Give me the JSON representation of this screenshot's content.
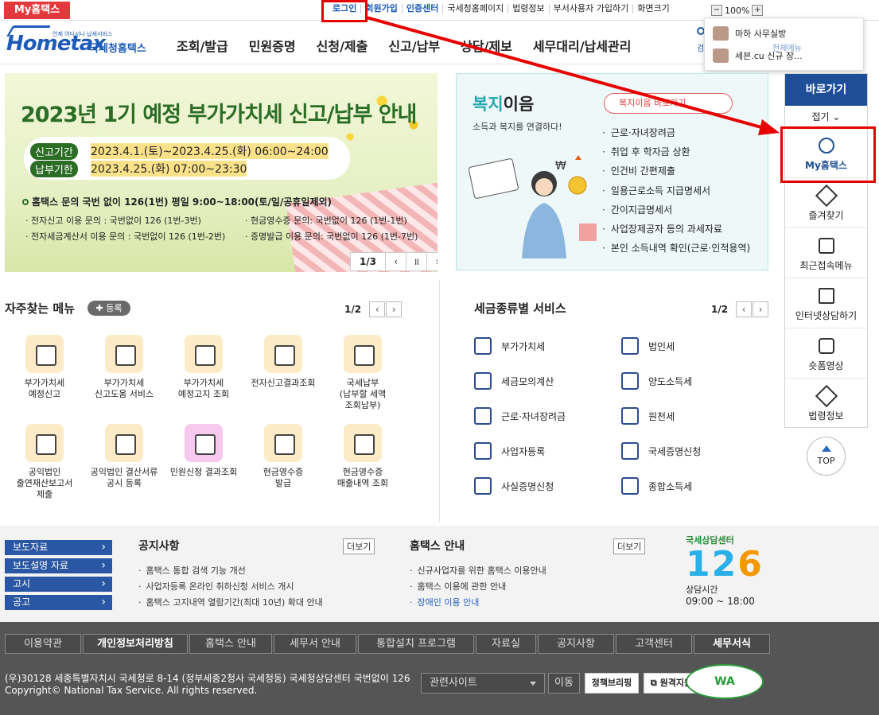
{
  "topbar": {
    "my_tab": "My홈택스",
    "links": [
      "로그인",
      "회원가입",
      "인증센터",
      "국세청홈페이지",
      "법령정보",
      "부서사용자 가입하기",
      "화면크기"
    ],
    "zoom": "100%"
  },
  "logo": {
    "sub": "언제 어디서나 납세서비스",
    "brand": "Hometax",
    "name": "국세청홈택스"
  },
  "gnb": [
    "조회/발급",
    "민원증명",
    "신청/제출",
    "신고/납부",
    "상담/제보",
    "세무대리/납세관리"
  ],
  "popup": {
    "items": [
      "마하 사무실방",
      "세븐.cu 신규 장..."
    ],
    "side": [
      "검",
      "전체메뉴"
    ]
  },
  "banner": {
    "title": "2023년 1기 예정 부가가치세 신고/납부 안내",
    "period1_label": "신고기간",
    "period1": "2023.4.1.(토)~2023.4.25.(화) 06:00~24:00",
    "period2_label": "납부기한",
    "period2": "2023.4.25.(화) 07:00~23:30",
    "info": "홈택스 문의 국번 없이 126(1번) 평일 9:00~18:00(토/일/공휴일제외)",
    "lines": [
      "· 전자신고 이용 문의 : 국번없이 126 (1번-3번)",
      "· 현금영수증 문의: 국번없이 126 (1번-1번)",
      "· 전자세금계산서 이용 문의 : 국번없이 126 (1번-2번)",
      "· 증명발급 이용 문의: 국번없이 126 (1번-7번)"
    ],
    "page": "1/3"
  },
  "welfare": {
    "title_a": "복지",
    "title_b": "이음",
    "sub": "소득과 복지를 연결하다!",
    "button": "복지이음 바로가기",
    "items": [
      "근로·자녀장려금",
      "취업 후 학자금 상환",
      "인건비 간편제출",
      "일용근로소득 지급명세서",
      "간이지급명세서",
      "사업장제공자 등의 과세자료",
      "본인 소득내역 확인(근로·인적용역)"
    ]
  },
  "frequent": {
    "title": "자주찾는 메뉴",
    "add": "등록",
    "page": "1/2",
    "items": [
      "부가가치세\n예정신고",
      "부가가치세\n신고도움 서비스",
      "부가가치세\n예정고지 조회",
      "전자신고결과조회",
      "국세납부\n(납부할 세액\n조회납부)",
      "공익법인\n출연재산보고서\n제출",
      "공익법인 결산서류\n공시 등록",
      "민원신청 결과조회",
      "현금영수증\n발급",
      "현금영수증\n매출내역 조회"
    ]
  },
  "taxservice": {
    "title": "세금종류별 서비스",
    "page": "1/2",
    "items": [
      "부가가치세",
      "법인세",
      "세금모의계산",
      "양도소득세",
      "근로·자녀장려금",
      "원천세",
      "사업자등록",
      "국세증명신청",
      "사실증명신청",
      "종합소득세"
    ]
  },
  "quick": {
    "title": "바로가기",
    "fold": "접기",
    "items": [
      "My홈택스",
      "즐겨찾기",
      "최근접속메뉴",
      "인터넷상담하기",
      "숏폼영상",
      "법령정보"
    ],
    "top": "TOP"
  },
  "news": {
    "tabs": [
      "보도자료",
      "보도설명 자료",
      "고시",
      "공고"
    ],
    "notice_title": "공지사항",
    "notice_more": "더보기",
    "notices": [
      "홈택스 통합 검색 기능 개선",
      "사업자등록 온라인 취하신청 서비스 개시",
      "홈택스 고지내역 열람기간(최대 10년) 확대 안내"
    ],
    "guide_title": "홈택스 안내",
    "guide_more": "더보기",
    "guides": [
      "신규사업자를 위한 홈택스 이용안내",
      "홈택스 이용에 관한 안내",
      "장애인 이용 안내"
    ]
  },
  "center": {
    "top": "국세상담센터",
    "num_a": "12",
    "num_b": "6",
    "label": "상담시간",
    "hours": "09:00 ~ 18:00"
  },
  "footer": {
    "nav": [
      "이용약관",
      "개인정보처리방침",
      "홈택스 안내",
      "세무서 안내",
      "통합설치 프로그램",
      "자료실",
      "공지사항",
      "고객센터",
      "세무서식"
    ],
    "addr1": "(우)30128 세종특별자치시 국세청로 8-14 (정부세종2청사 국세청동) 국세청상담센터 국번없이 126",
    "addr2": "Copyright© National Tax Service. All rights reserved.",
    "select": "관련사이트",
    "go": "이동",
    "badge1": "정책브리핑",
    "badge2": "원격지원",
    "wa": "WA"
  }
}
